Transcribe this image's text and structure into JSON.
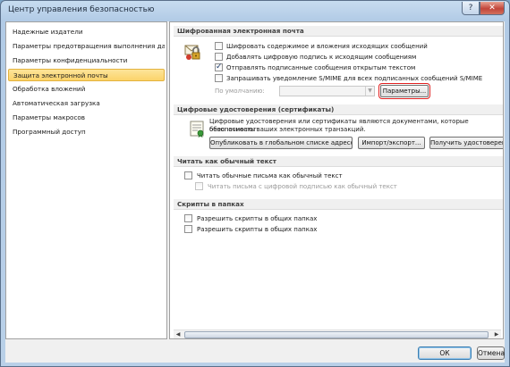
{
  "window": {
    "title": "Центр управления безопасностью",
    "help_button": "?",
    "close_button": "✕"
  },
  "sidebar": {
    "items": [
      {
        "label": "Надежные издатели",
        "selected": false
      },
      {
        "label": "Параметры предотвращения выполнения данных",
        "selected": false
      },
      {
        "label": "Параметры конфиденциальности",
        "selected": false
      },
      {
        "label": "Защита электронной почты",
        "selected": true
      },
      {
        "label": "Обработка вложений",
        "selected": false
      },
      {
        "label": "Автоматическая загрузка",
        "selected": false
      },
      {
        "label": "Параметры макросов",
        "selected": false
      },
      {
        "label": "Программный доступ",
        "selected": false
      }
    ]
  },
  "encrypted_mail": {
    "heading": "Шифрованная электронная почта",
    "options": [
      {
        "label": "Шифровать содержимое и вложения исходящих сообщений",
        "checked": false
      },
      {
        "label": "Добавлять цифровую подпись к исходящим сообщениям",
        "checked": false
      },
      {
        "label": "Отправлять подписанные сообщения открытым текстом",
        "checked": true
      },
      {
        "label": "Запрашивать уведомление S/MIME для всех подписанных сообщений S/MIME",
        "checked": false
      }
    ],
    "default_label": "По умолчанию:",
    "default_value": "",
    "settings_button": "Параметры..."
  },
  "certificates": {
    "heading": "Цифровые удостоверения (сертификаты)",
    "description_line1": "Цифровые удостоверения или сертификаты являются документами, которые обеспечивают",
    "description_line2": "безопасность ваших электронных транзакций.",
    "publish_button": "Опубликовать в глобальном списке адресов...",
    "import_export_button": "Импорт/экспорт...",
    "get_id_button": "Получить удостоверение..."
  },
  "plain_text": {
    "heading": "Читать как обычный текст",
    "options": [
      {
        "label": "Читать обычные письма как обычный текст",
        "checked": false,
        "disabled": false
      },
      {
        "label": "Читать письма с цифровой подписью как обычный текст",
        "checked": false,
        "disabled": true
      }
    ]
  },
  "folder_scripts": {
    "heading": "Скрипты в папках",
    "options": [
      {
        "label": "Разрешить скрипты в общих папках",
        "checked": false
      },
      {
        "label": "Разрешить скрипты в общих папках",
        "checked": false
      }
    ]
  },
  "footer": {
    "ok": "ОК",
    "cancel": "Отмена"
  }
}
